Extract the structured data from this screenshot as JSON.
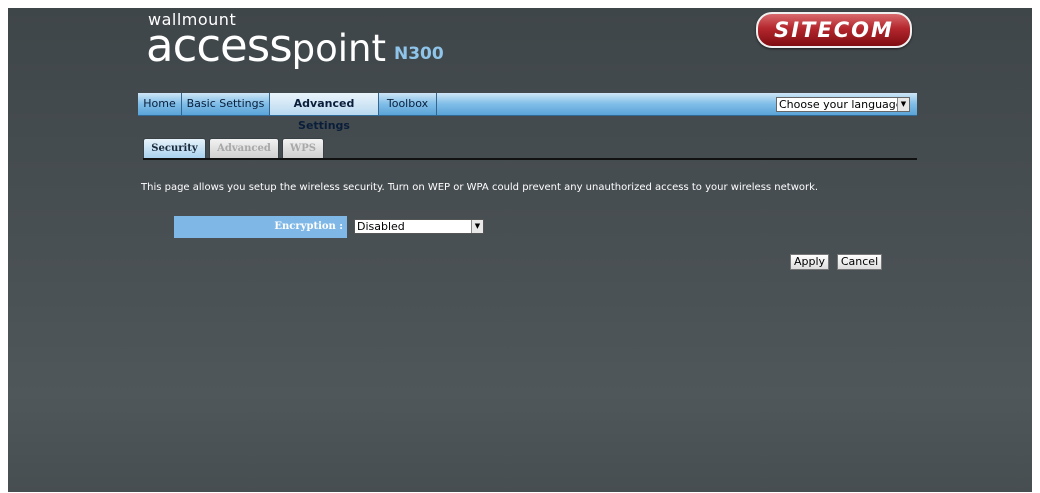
{
  "header": {
    "logo_small": "wallmount",
    "logo_access": "access",
    "logo_point": "point",
    "logo_model": "N300",
    "brand": "SITECOM"
  },
  "nav": {
    "items": [
      {
        "label": "Home",
        "active": false
      },
      {
        "label": "Basic Settings",
        "active": false
      },
      {
        "label": "Advanced Settings",
        "active": true
      },
      {
        "label": "Toolbox",
        "active": false
      }
    ],
    "language_select": "Choose your language"
  },
  "tabs": [
    {
      "label": "Security",
      "active": true
    },
    {
      "label": "Advanced",
      "active": false
    },
    {
      "label": "WPS",
      "active": false
    }
  ],
  "main": {
    "description": "This page allows you setup the wireless security. Turn on WEP or WPA could prevent any unauthorized access to your wireless network.",
    "encryption_label": "Encryption :",
    "encryption_value": "Disabled",
    "apply_label": "Apply",
    "cancel_label": "Cancel"
  },
  "colors": {
    "background": "#474e51",
    "nav_blue": "#7fbde8",
    "label_blue": "#7fb8e6",
    "brand_red": "#b3272d"
  },
  "icons": {
    "select_arrow": "chevron-down-icon"
  }
}
